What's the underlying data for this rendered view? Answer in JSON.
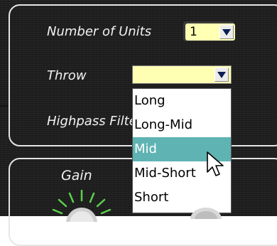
{
  "panel": {
    "number_of_units_label": "Number of Units",
    "number_of_units_value": "1",
    "throw_label": "Throw",
    "throw_value": "",
    "highpass_label": "Highpass Filter"
  },
  "throw_options": [
    "Long",
    "Long-Mid",
    "Mid",
    "Mid-Short",
    "Short"
  ],
  "throw_highlighted": "Mid",
  "gain": {
    "label": "Gain"
  },
  "colors": {
    "panel_background": "#1e1e1e",
    "panel_border": "#e6e6e6",
    "select_background": "#ffffb4",
    "highlight": "#5fb3b3",
    "arrow": "#0b1f52",
    "knob_ticks": "#5bd14a"
  },
  "icons": [
    "dropdown-arrow-icon",
    "pointer-cursor-icon",
    "gain-knob-icon"
  ]
}
